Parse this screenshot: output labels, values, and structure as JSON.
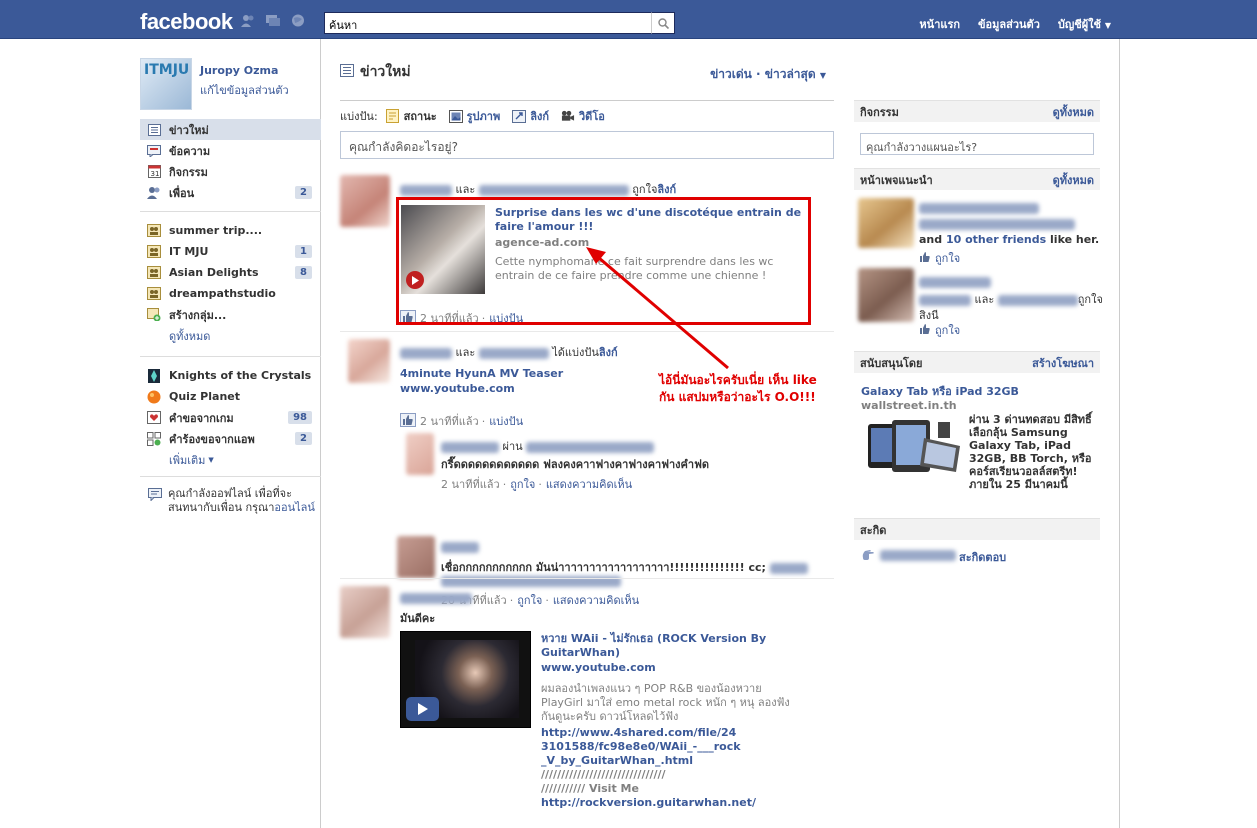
{
  "topbar": {
    "logo": "facebook",
    "search_placeholder": "ค้นหา",
    "nav": [
      "หน้าแรก",
      "ข้อมูลส่วนตัว",
      "บัญชีผู้ใช้"
    ]
  },
  "profile": {
    "avatar_text": "ITMJU",
    "name": "Juropy Ozma",
    "edit": "แก้ไขข้อมูลส่วนตัว"
  },
  "nav_main": [
    {
      "label": "ข่าวใหม่",
      "icon": "news-feed-icon",
      "count": ""
    },
    {
      "label": "ข้อความ",
      "icon": "messages-icon",
      "count": ""
    },
    {
      "label": "กิจกรรม",
      "icon": "events-icon",
      "count": ""
    },
    {
      "label": "เพื่อน",
      "icon": "friends-icon",
      "count": "2"
    }
  ],
  "nav_groups": [
    {
      "label": "summer trip....",
      "count": ""
    },
    {
      "label": "IT MJU",
      "count": "1"
    },
    {
      "label": "Asian Delights",
      "count": "8"
    },
    {
      "label": "dreampathstudio",
      "count": ""
    },
    {
      "label": "สร้างกลุ่ม...",
      "count": ""
    }
  ],
  "nav_groups_more": "ดูทั้งหมด",
  "nav_apps": [
    {
      "label": "Knights of the Crystals",
      "count": ""
    },
    {
      "label": "Quiz Planet",
      "count": ""
    },
    {
      "label": "คำขอจากเกม",
      "count": "98"
    },
    {
      "label": "คำร้องขอจากแอพ",
      "count": "2"
    }
  ],
  "nav_apps_more": "เพิ่มเติม",
  "offline_text": "คุณกำลังออฟไลน์ เพื่อที่จะสนทนากับเพื่อน กรุณา",
  "offline_link": "ออนไลน์",
  "feed": {
    "title": "ข่าวใหม่",
    "sort_top": "ข่าวเด่น",
    "sort_recent": "ข่าวล่าสุด",
    "share_label": "แบ่งปัน:",
    "share_options": [
      "สถานะ",
      "รูปภาพ",
      "ลิงก์",
      "วิดีโอ"
    ],
    "composer_placeholder": "คุณกำลังคิดอะไรอยู่?"
  },
  "story1": {
    "connector": "และ",
    "action": "ถูกใจ",
    "object": "ลิงก์",
    "att_title": "Surprise dans les wc d'une discotéque entrain de faire l'amour !!!",
    "att_url": "agence-ad.com",
    "att_desc": "Cette nymphomane ce fait surprendre dans les wc entrain de ce faire prendre comme une chienne !",
    "time": "2 นาทีที่แล้ว",
    "share": "แบ่งปัน"
  },
  "story2": {
    "connector": "และ",
    "action": "ได้แบ่งปัน",
    "object": "ลิงก์",
    "att_title": "4minute HyunA MV Teaser",
    "att_url": "www.youtube.com",
    "time": "2 นาทีที่แล้ว",
    "share": "แบ่งปัน",
    "comment1_connector": "ผ่าน",
    "comment1_text": "กรี๊ดดดดดดดดดดดด ฟลงคงคาาฟางคาฟางคาฟางคำฟด",
    "comment1_time": "2 นาทีที่แล้ว",
    "comment1_like": "ถูกใจ",
    "comment1_comment": "แสดงความคิดเห็น",
    "comment2_text": "เชื่อกกกกกกกกกกก มันน่าาาาาาาาาาาาาาาาาา!!!!!!!!!!!!!!! cc;",
    "comment2_time": "20 นาทีที่แล้ว",
    "comment2_like": "ถูกใจ",
    "comment2_comment": "แสดงความคิดเห็น"
  },
  "story3": {
    "text": "มันดีคะ",
    "att_title": "หวาย WAii - ไม่รักเธอ (ROCK Version By GuitarWhan)",
    "att_url": "www.youtube.com",
    "att_desc": "ผมลองนำเพลงแนว ๆ POP R&B ของน้องหวาย PlayGirl มาใส่ emo metal rock หนัก ๆ หนุ ลองฟังกันดูนะครับ ดาวน์โหลดไว้ฟัง",
    "link1a": "http://www.4shared.com/file/24",
    "link1b": "3101588/fc98e8e0/WAii_-___rock",
    "link1c": "_V_by_GuitarWhan_.html",
    "slashes1": "///////////////////////////////",
    "slashes2": "///////////",
    "visit": "Visit Me",
    "link2": "http://rockversion.guitarwhan.net/"
  },
  "annotation": {
    "text": "ไอ้นี่มันอะไรครับเนี่ย เห็น like กัน แสปมหรือว่าอะไร O.O!!!"
  },
  "right": {
    "events_title": "กิจกรรม",
    "events_link": "ดูทั้งหมด",
    "events_placeholder": "คุณกำลังวางแผนอะไร?",
    "pages_title": "หน้าเพจแนะนำ",
    "pages_link": "ดูทั้งหมด",
    "page1_friends_pre": "and",
    "page1_friends_link": "10 other friends",
    "page1_friends_post": "like her.",
    "like": "ถูกใจ",
    "page2_connector": "และ",
    "page2_action": "ถูกใจ",
    "page2_obj": "สิงนี",
    "ads_title": "สนับสนุนโดย",
    "ads_link": "สร้างโฆษณา",
    "ad_title": "Galaxy Tab หรือ iPad 32GB",
    "ad_url": "wallstreet.in.th",
    "ad_text": "ผ่าน 3 ด่านทดสอบ มีสิทธิ์เลือกลุ้น Samsung Galaxy Tab, iPad 32GB, BB Torch, หรือ คอร์สเรียนวอลล์สตรีท! ภายใน 25 มีนาคมนี้",
    "poke_title": "สะกิด",
    "poke_action": "สะกิดตอบ"
  },
  "colors": {
    "brand": "#3b5998",
    "annotation": "#e00000"
  }
}
